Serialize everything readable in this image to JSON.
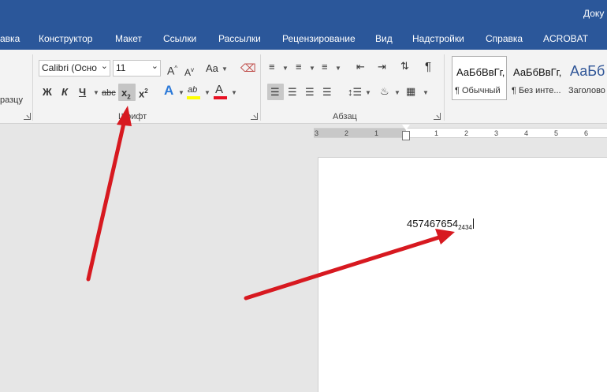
{
  "window": {
    "title": "Доку"
  },
  "tabs": [
    "авка",
    "Конструктор",
    "Макет",
    "Ссылки",
    "Рассылки",
    "Рецензирование",
    "Вид",
    "Надстройки",
    "Справка",
    "ACROBAT"
  ],
  "clipboard": {
    "label_fragment": "разцу"
  },
  "font_group": {
    "font_name": "Calibri (Осно",
    "font_size": "11",
    "grow_label": "A",
    "shrink_label": "A",
    "case_label": "Aa",
    "bold_label": "Ж",
    "italic_label": "К",
    "underline_label": "Ч",
    "strike_label": "abc",
    "subscript_label": "x",
    "superscript_label": "x",
    "effects_label": "A",
    "highlight_label": "ab",
    "font_color_label": "A",
    "group_label": "Шрифт"
  },
  "paragraph_group": {
    "group_label": "Абзац",
    "pilcrow": "¶"
  },
  "styles": [
    {
      "preview": "АаБбВвГг,",
      "name": "¶ Обычный"
    },
    {
      "preview": "АаБбВвГг,",
      "name": "¶ Без инте..."
    },
    {
      "preview": "АаБб",
      "name": "Заголово"
    }
  ],
  "ruler": {
    "labels": [
      "3",
      "2",
      "1",
      "1",
      "2",
      "3",
      "4",
      "5",
      "6"
    ]
  },
  "document": {
    "main_text": "457467654",
    "subscript_text": "2434"
  },
  "colors": {
    "accent": "#2b579a",
    "arrow": "#d71920",
    "highlight": "#ffff00",
    "font_color": "#e81123"
  }
}
